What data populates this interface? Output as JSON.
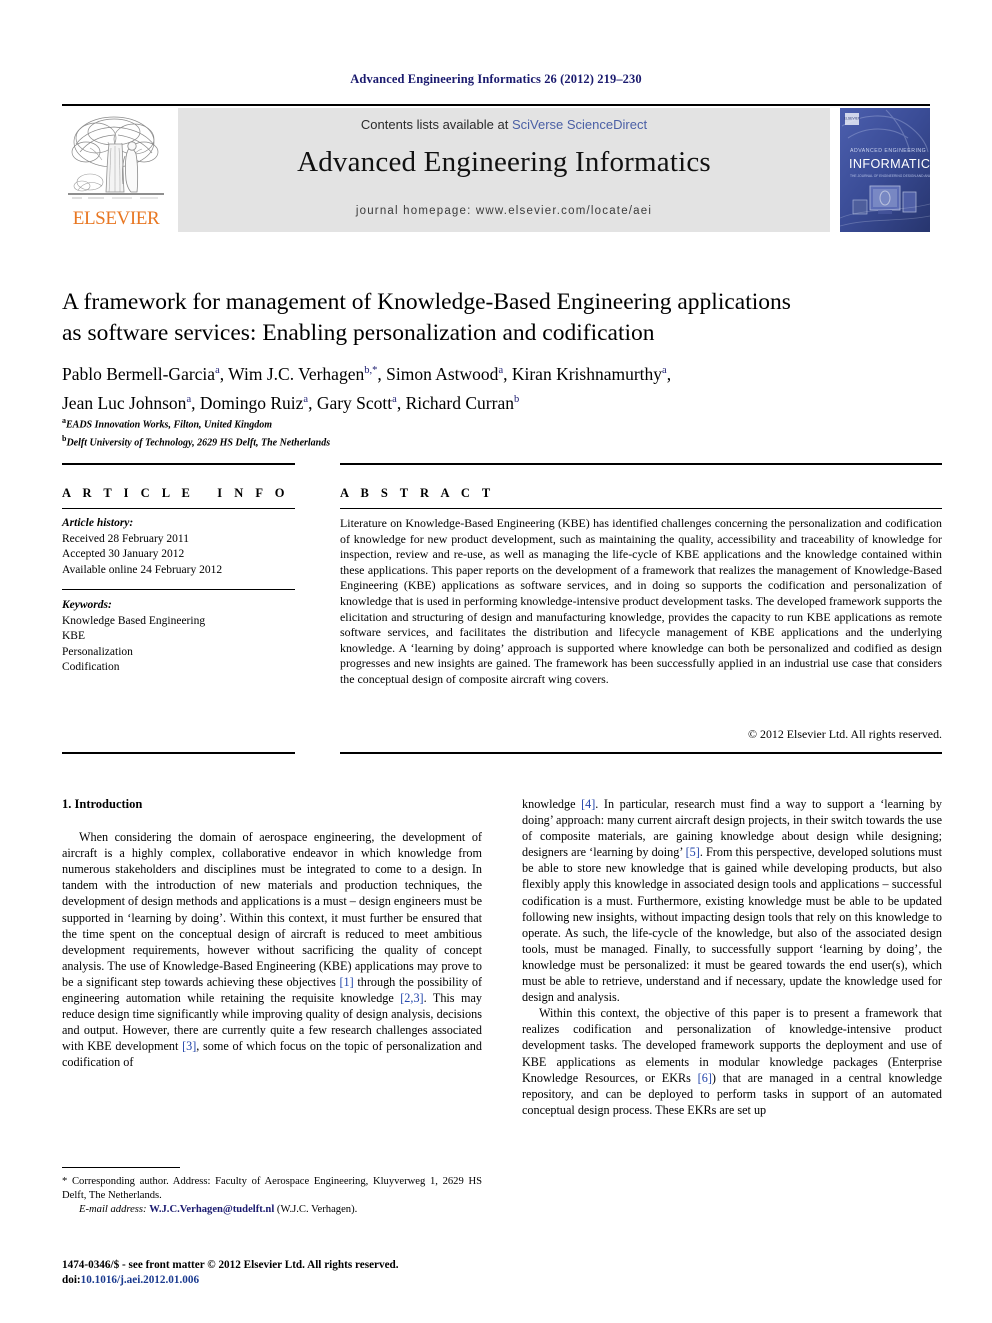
{
  "running_head": "Advanced Engineering Informatics 26 (2012) 219–230",
  "masthead": {
    "contents_prefix": "Contents lists available at ",
    "contents_link": "SciVerse ScienceDirect",
    "journal_name": "Advanced Engineering Informatics",
    "homepage": "journal homepage: www.elsevier.com/locate/aei",
    "publisher_wordmark": "ELSEVIER",
    "cover_title_small": "ADVANCED ENGINEERING",
    "cover_title_large": "INFORMATICS",
    "cover_subtitle": "THE JOURNAL OF ENGINEERING DESIGN, ANALYSIS AND MANUFACTURE"
  },
  "article": {
    "title_line1": "A framework for management of Knowledge-Based Engineering applications",
    "title_line2": "as software services: Enabling personalization and codification",
    "authors_line1": "Pablo Bermell-Garcia a, Wim J.C. Verhagen b,*, Simon Astwood a, Kiran Krishnamurthy a,",
    "authors_line2": "Jean Luc Johnson a, Domingo Ruiz a, Gary Scott a, Richard Curran b",
    "affiliation_a": "EADS Innovation Works, Filton, United Kingdom",
    "affiliation_b": "Delft University of Technology, 2629 HS Delft, The Netherlands"
  },
  "info": {
    "heading": "A R T I C L E  I N F O",
    "history_label": "Article history:",
    "received": "Received 28 February 2011",
    "accepted": "Accepted 30 January 2012",
    "available": "Available online 24 February 2012",
    "keywords_label": "Keywords:",
    "keywords": [
      "Knowledge Based Engineering",
      "KBE",
      "Personalization",
      "Codification"
    ]
  },
  "abstract": {
    "heading": "A B S T R A C T",
    "text": "Literature on Knowledge-Based Engineering (KBE) has identified challenges concerning the personalization and codification of knowledge for new product development, such as maintaining the quality, accessibility and traceability of knowledge for inspection, review and re-use, as well as managing the life-cycle of KBE applications and the knowledge contained within these applications. This paper reports on the development of a framework that realizes the management of Knowledge-Based Engineering (KBE) applications as software services, and in doing so supports the codification and personalization of knowledge that is used in performing knowledge-intensive product development tasks. The developed framework supports the elicitation and structuring of design and manufacturing knowledge, provides the capacity to run KBE applications as remote software services, and facilitates the distribution and lifecycle management of KBE applications and the underlying knowledge. A ‘learning by doing’ approach is supported where knowledge can both be personalized and codified as design progresses and new insights are gained. The framework has been successfully applied in an industrial use case that considers the conceptual design of composite aircraft wing covers.",
    "copyright": "© 2012 Elsevier Ltd. All rights reserved."
  },
  "body": {
    "section_title": "1. Introduction",
    "left_para1_a": "When considering the domain of aerospace engineering, the development of aircraft is a highly complex, collaborative endeavor in which knowledge from numerous stakeholders and disciplines must be integrated to come to a design. In tandem with the introduction of new materials and production techniques, the development of design methods and applications is a must – design engineers must be supported in ‘learning by doing’. Within this context, it must further be ensured that the time spent on the conceptual design of aircraft is reduced to meet ambitious development requirements, however without sacrificing the quality of concept analysis. The use of Knowledge-Based Engineering (KBE) applications may prove to be a significant step towards achieving these objectives ",
    "left_ref_1": "[1]",
    "left_para1_b": " through the possibility of engineering automation while retaining the requisite knowledge ",
    "left_ref_23": "[2,3]",
    "left_para1_c": ". This may reduce design time significantly while improving quality of design analysis, decisions and output. However, there are currently quite a few research challenges associated with KBE development ",
    "left_ref_3": "[3]",
    "left_para1_d": ", some of which focus on the topic of personalization and codification of",
    "right_cont_a": "knowledge ",
    "right_ref_4": "[4]",
    "right_cont_b": ". In particular, research must find a way to support a ‘learning by doing’ approach: many current aircraft design projects, in their switch towards the use of composite materials, are gaining knowledge about design while designing; designers are ‘learning by doing’ ",
    "right_ref_5": "[5]",
    "right_cont_c": ". From this perspective, developed solutions must be able to store new knowledge that is gained while developing products, but also flexibly apply this knowledge in associated design tools and applications – successful codification is a must. Furthermore, existing knowledge must be able to be updated following new insights, without impacting design tools that rely on this knowledge to operate. As such, the life-cycle of the knowledge, but also of the associated design tools, must be managed. Finally, to successfully support ‘learning by doing’, the knowledge must be personalized: it must be geared towards the end user(s), which must be able to retrieve, understand and if necessary, update the knowledge used for design and analysis.",
    "right_para2_a": "Within this context, the objective of this paper is to present a framework that realizes codification and personalization of knowledge-intensive product development tasks. The developed framework supports the deployment and use of KBE applications as elements in modular knowledge packages (Enterprise Knowledge Resources, or EKRs ",
    "right_ref_6": "[6]",
    "right_para2_b": ") that are managed in a central knowledge repository, and can be deployed to perform tasks in support of an automated conceptual design process. These EKRs are set up"
  },
  "footnotes": {
    "corresponding": "* Corresponding author. Address: Faculty of Aerospace Engineering, Kluyverweg 1, 2629 HS Delft, The Netherlands.",
    "email_label": "E-mail address:",
    "email": "W.J.C.Verhagen@tudelft.nl",
    "email_owner": "(W.J.C. Verhagen)."
  },
  "imprint": {
    "line1": "1474-0346/$ - see front matter © 2012 Elsevier Ltd. All rights reserved.",
    "doi_label": "doi:",
    "doi": "10.1016/j.aei.2012.01.006"
  },
  "colors": {
    "running_head": "#1a1a6e",
    "link": "#4a5fa5",
    "reference": "#2244aa",
    "elsevier_orange": "#e87722",
    "banner_bg": "#e3e3e3",
    "cover_blue": "#3b4f9e"
  }
}
